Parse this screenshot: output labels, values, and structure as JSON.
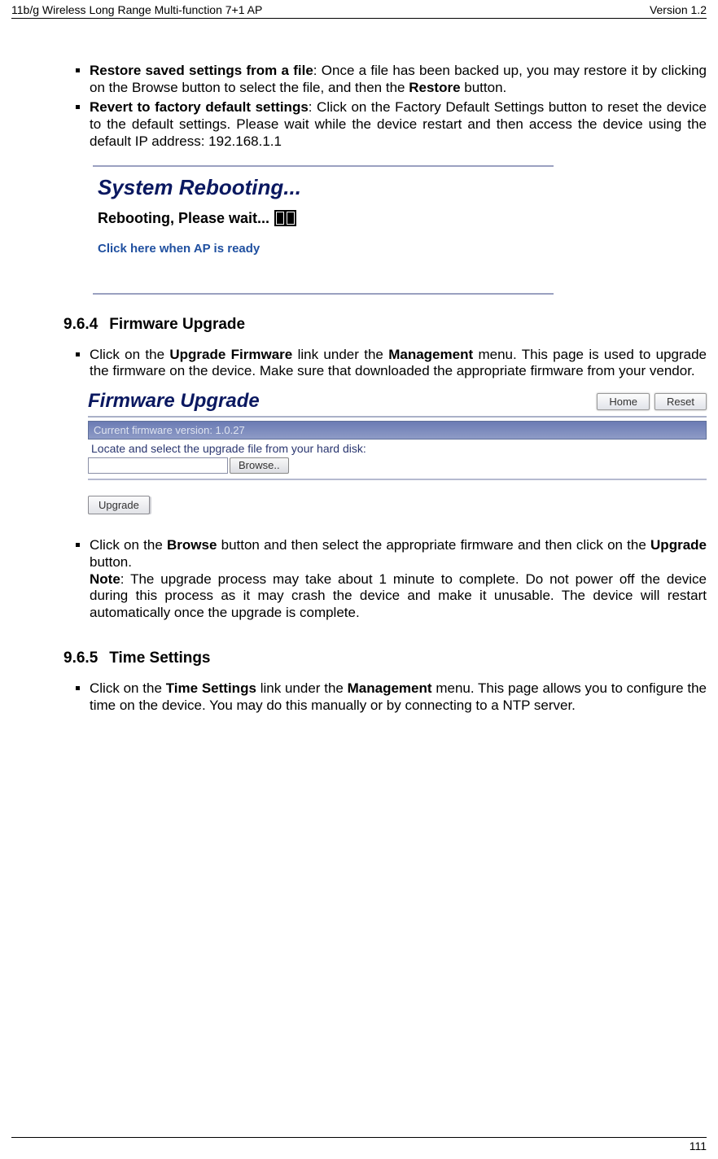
{
  "header": {
    "left": "11b/g Wireless Long Range Multi-function 7+1 AP",
    "right": "Version 1.2"
  },
  "bullets_a": {
    "b1_lead": "Restore saved settings from a file",
    "b1_body": ": Once a file has been backed up, you may restore it by clicking on the Browse button to select the file, and then the ",
    "b1_bold2": "Restore",
    "b1_tail": " button.",
    "b2_lead": "Revert to factory default settings",
    "b2_body": ": Click on the Factory Default Settings button to reset the device to the default settings. Please wait while the device restart and then access the device using the default IP address: 192.168.1.1"
  },
  "fig_reboot": {
    "title": "System Rebooting...",
    "wait": "Rebooting, Please wait...",
    "link": "Click here when AP is ready"
  },
  "section_964": {
    "num": "9.6.4",
    "title": "Firmware Upgrade"
  },
  "bullets_b": {
    "b1_pre": "Click on the ",
    "b1_b1": "Upgrade Firmware",
    "b1_mid": " link under the ",
    "b1_b2": "Management",
    "b1_post": " menu. This page is used to upgrade the firmware on the device. Make sure that downloaded the appropriate firmware from your vendor."
  },
  "fw_panel": {
    "title": "Firmware Upgrade",
    "home": "Home",
    "reset": "Reset",
    "version_bar": "Current firmware version: 1.0.27",
    "locate": "Locate and select the upgrade file from your hard disk:",
    "browse": "Browse..",
    "upgrade": "Upgrade"
  },
  "bullets_c": {
    "b1_pre": "Click on the ",
    "b1_b1": "Browse",
    "b1_mid": " button and then select the appropriate firmware and then click on the ",
    "b1_b2": "Upgrade",
    "b1_post": " button.",
    "note_lead": "Note",
    "note_body": ": The upgrade process may take about 1 minute to complete. Do not power off the device during this process as it may crash the device and make it unusable. The device will restart automatically once the upgrade is complete."
  },
  "section_965": {
    "num": "9.6.5",
    "title": "Time Settings"
  },
  "bullets_d": {
    "b1_pre": "Click on the ",
    "b1_b1": "Time Settings",
    "b1_mid": " link under the ",
    "b1_b2": "Management",
    "b1_post": " menu. This page allows you to configure the time on the device. You may do this manually or by connecting to a NTP server."
  },
  "footer": {
    "page": "111"
  }
}
